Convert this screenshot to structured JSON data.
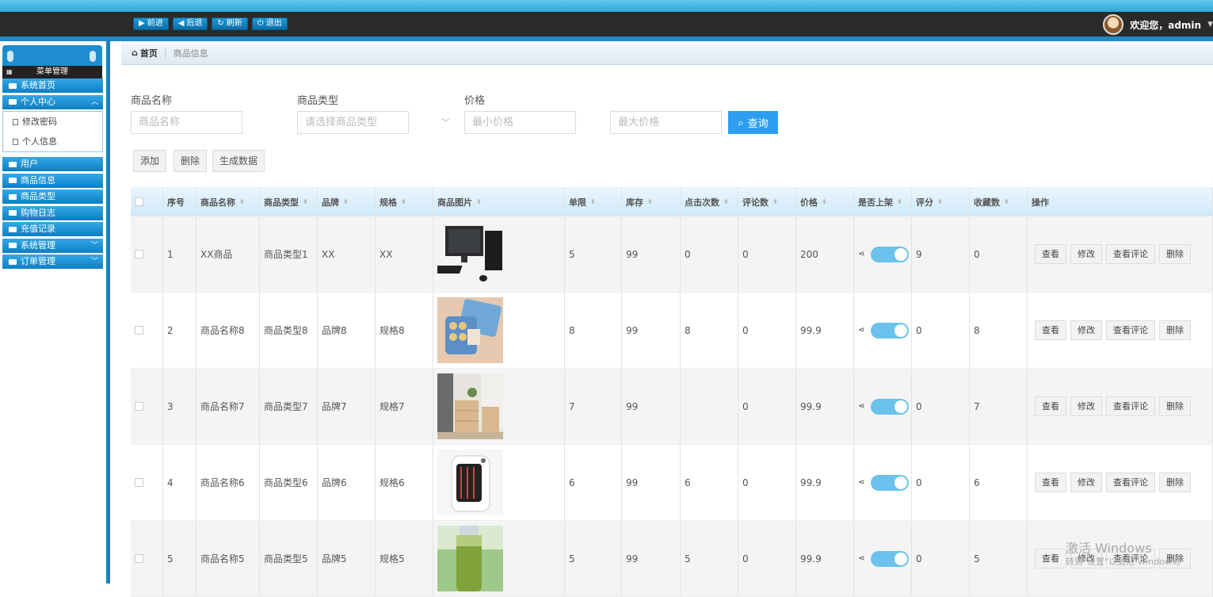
{
  "topnav": {
    "buttons": [
      {
        "label": "前进",
        "icon": "play-icon"
      },
      {
        "label": "后退",
        "icon": "back-icon"
      },
      {
        "label": "刷新",
        "icon": "refresh-icon"
      },
      {
        "label": "退出",
        "icon": "power-icon"
      }
    ],
    "welcome": "欢迎您，admin"
  },
  "sidebar": {
    "title": "菜单管理",
    "items": [
      {
        "label": "系统首页"
      },
      {
        "label": "个人中心",
        "expanded": true,
        "sub": [
          "修改密码",
          "个人信息"
        ]
      },
      {
        "label": "用户"
      },
      {
        "label": "商品信息"
      },
      {
        "label": "商品类型"
      },
      {
        "label": "购物日志"
      },
      {
        "label": "充值记录"
      },
      {
        "label": "系统管理",
        "chevron": true
      },
      {
        "label": "订单管理",
        "chevron": true
      }
    ]
  },
  "breadcrumb": {
    "home": "首页",
    "current": "商品信息"
  },
  "search": {
    "name_label": "商品名称",
    "name_placeholder": "商品名称",
    "type_label": "商品类型",
    "type_placeholder": "请选择商品类型",
    "price_label": "价格",
    "min_placeholder": "最小价格",
    "max_placeholder": "最大价格",
    "query_label": "查询"
  },
  "actions": {
    "add": "添加",
    "delete": "删除",
    "generate": "生成数据"
  },
  "table": {
    "headers": [
      "序号",
      "商品名称",
      "商品类型",
      "品牌",
      "规格",
      "商品图片",
      "单限",
      "库存",
      "点击次数",
      "评论数",
      "价格",
      "是否上架",
      "评分",
      "收藏数",
      "操作"
    ],
    "rows": [
      {
        "no": "1",
        "name": "XX商品",
        "type": "商品类型1",
        "brand": "XX",
        "spec": "XX",
        "image": "computer",
        "limit": "5",
        "stock": "99",
        "clicks": "0",
        "comments": "0",
        "price": "200",
        "on_sale": true,
        "score": "9",
        "favorites": "0"
      },
      {
        "no": "2",
        "name": "商品名称8",
        "type": "商品类型8",
        "brand": "品牌8",
        "spec": "规格8",
        "image": "snack-box",
        "limit": "8",
        "stock": "99",
        "clicks": "8",
        "comments": "0",
        "price": "99.9",
        "on_sale": true,
        "score": "0",
        "favorites": "8"
      },
      {
        "no": "3",
        "name": "商品名称7",
        "type": "商品类型7",
        "brand": "品牌7",
        "spec": "规格7",
        "image": "cabinet",
        "limit": "7",
        "stock": "99",
        "clicks": "",
        "comments": "0",
        "price": "99.9",
        "on_sale": true,
        "score": "0",
        "favorites": "7"
      },
      {
        "no": "4",
        "name": "商品名称6",
        "type": "商品类型6",
        "brand": "品牌6",
        "spec": "规格6",
        "image": "heater",
        "limit": "6",
        "stock": "99",
        "clicks": "6",
        "comments": "0",
        "price": "99.9",
        "on_sale": true,
        "score": "0",
        "favorites": "6"
      },
      {
        "no": "5",
        "name": "商品名称5",
        "type": "商品类型5",
        "brand": "品牌5",
        "spec": "规格5",
        "image": "bottle",
        "limit": "5",
        "stock": "99",
        "clicks": "5",
        "comments": "0",
        "price": "99.9",
        "on_sale": true,
        "score": "0",
        "favorites": "5"
      }
    ],
    "row_ops": [
      "查看",
      "修改",
      "查看评论",
      "删除"
    ]
  },
  "watermark": {
    "line1": "激活 Windows",
    "line2": "转到\"设置\"以激活 Windows。"
  }
}
